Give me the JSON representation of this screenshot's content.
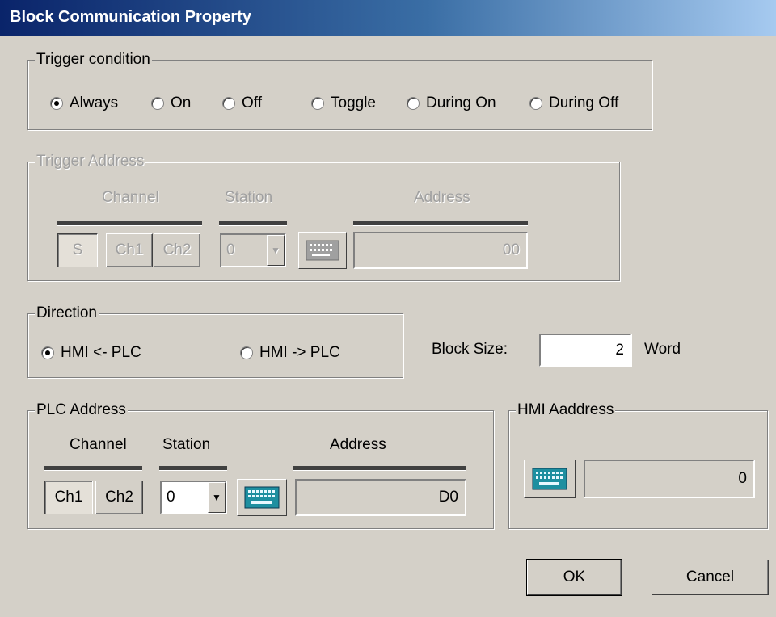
{
  "window": {
    "title": "Block Communication Property"
  },
  "trigger_condition": {
    "legend": "Trigger condition",
    "options": [
      "Always",
      "On",
      "Off",
      "Toggle",
      "During On",
      "During Off"
    ],
    "selected": "Always"
  },
  "trigger_address": {
    "legend": "Trigger Address",
    "channel_label": "Channel",
    "station_label": "Station",
    "address_label": "Address",
    "channel_buttons": [
      "S",
      "Ch1",
      "Ch2"
    ],
    "station_value": "0",
    "address_value": "00",
    "enabled": false
  },
  "direction": {
    "legend": "Direction",
    "options": [
      "HMI <- PLC",
      "HMI -> PLC"
    ],
    "selected": "HMI <- PLC"
  },
  "block_size": {
    "label": "Block Size:",
    "value": "2",
    "unit": "Word"
  },
  "plc_address": {
    "legend": "PLC Address",
    "channel_label": "Channel",
    "station_label": "Station",
    "address_label": "Address",
    "channel_buttons": [
      "Ch1",
      "Ch2"
    ],
    "station_value": "0",
    "address_value": "D0"
  },
  "hmi_address": {
    "legend": "HMI Aaddress",
    "address_value": "0"
  },
  "buttons": {
    "ok": "OK",
    "cancel": "Cancel"
  },
  "colors": {
    "face": "#d4d0c8",
    "title_start": "#0a246a",
    "title_end": "#a6caf0",
    "keyboard_icon": "#1e8fa0"
  }
}
